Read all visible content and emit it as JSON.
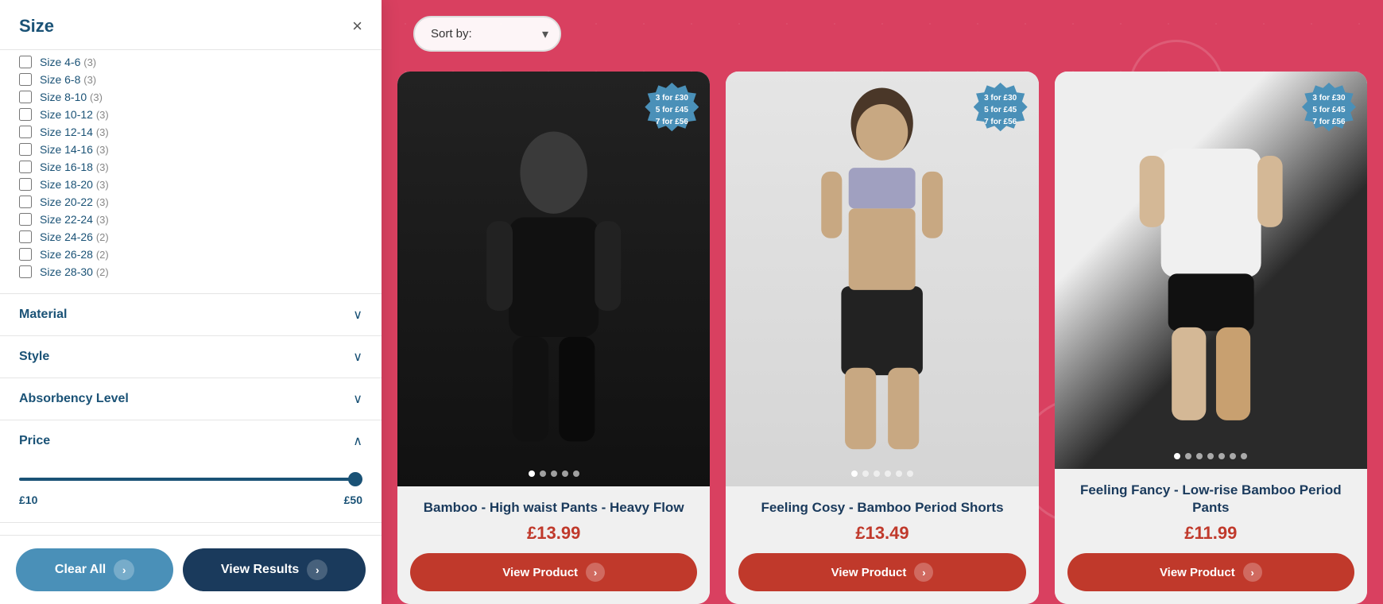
{
  "sidebar": {
    "title": "Size",
    "close_label": "×",
    "sizes": [
      {
        "label": "Size 4-6",
        "count": "(3)"
      },
      {
        "label": "Size 6-8",
        "count": "(3)"
      },
      {
        "label": "Size 8-10",
        "count": "(3)"
      },
      {
        "label": "Size 10-12",
        "count": "(3)"
      },
      {
        "label": "Size 12-14",
        "count": "(3)"
      },
      {
        "label": "Size 14-16",
        "count": "(3)"
      },
      {
        "label": "Size 16-18",
        "count": "(3)"
      },
      {
        "label": "Size 18-20",
        "count": "(3)"
      },
      {
        "label": "Size 20-22",
        "count": "(3)"
      },
      {
        "label": "Size 22-24",
        "count": "(3)"
      },
      {
        "label": "Size 24-26",
        "count": "(2)"
      },
      {
        "label": "Size 26-28",
        "count": "(2)"
      },
      {
        "label": "Size 28-30",
        "count": "(2)"
      }
    ],
    "sections": [
      {
        "label": "Material",
        "expanded": false
      },
      {
        "label": "Style",
        "expanded": false
      },
      {
        "label": "Absorbency Level",
        "expanded": false
      },
      {
        "label": "Price",
        "expanded": true
      }
    ],
    "price": {
      "min": "£10",
      "max": "£50"
    },
    "clear_all_label": "Clear All",
    "view_results_label": "View Results"
  },
  "sort": {
    "label": "Sort by:",
    "placeholder": "Sort by:"
  },
  "products": [
    {
      "name": "Bamboo - High waist Pants - Heavy Flow",
      "price": "£13.99",
      "view_label": "View Product",
      "badge": [
        "3 for £30",
        "5 for £45",
        "7 for £56"
      ],
      "dots": 5,
      "active_dot": 0
    },
    {
      "name": "Feeling Cosy - Bamboo Period Shorts",
      "price": "£13.49",
      "view_label": "View Product",
      "badge": [
        "3 for £30",
        "5 for £45",
        "7 for £56"
      ],
      "dots": 6,
      "active_dot": 0
    },
    {
      "name": "Feeling Fancy - Low-rise Bamboo Period Pants",
      "price": "£11.99",
      "view_label": "View Product",
      "badge": [
        "3 for £30",
        "5 for £45",
        "7 for £56"
      ],
      "dots": 7,
      "active_dot": 0
    }
  ]
}
